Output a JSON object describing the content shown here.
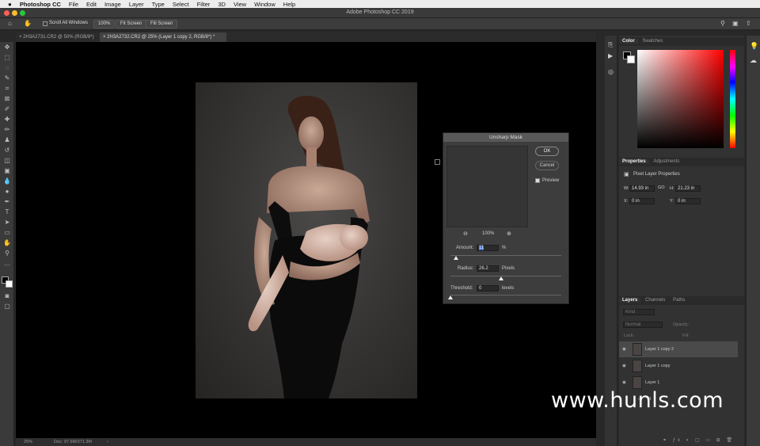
{
  "menu": {
    "apple": "",
    "app": "Photoshop CC",
    "items": [
      "File",
      "Edit",
      "Image",
      "Layer",
      "Type",
      "Select",
      "Filter",
      "3D",
      "View",
      "Window",
      "Help"
    ]
  },
  "window": {
    "title": "Adobe Photoshop CC 2019"
  },
  "options": {
    "scroll_all": "Scroll All Windows",
    "zoom": "100%",
    "fit": "Fit Screen",
    "fill": "Fill Screen"
  },
  "tabs": [
    "2H3A2731.CR2 @ 50% (RGB/8*)",
    "2H3A2732.CR2 @ 25% (Layer 1 copy 2, RGB/8*) *"
  ],
  "status": {
    "zoom": "25%",
    "doc": "Doc: 97.6M/371.3M"
  },
  "dialog": {
    "title": "Unsharp Mask",
    "ok": "OK",
    "cancel": "Cancel",
    "preview": "Preview",
    "zoom": "100%",
    "amount_label": "Amount:",
    "amount_value": "11",
    "amount_unit": "%",
    "radius_label": "Radius:",
    "radius_value": "26.2",
    "radius_unit": "Pixels",
    "threshold_label": "Threshold:",
    "threshold_value": "0",
    "threshold_unit": "levels"
  },
  "color_panel": {
    "tabs": [
      "Color",
      "Swatches"
    ]
  },
  "properties": {
    "tabs": [
      "Properties",
      "Adjustments"
    ],
    "title": "Pixel Layer Properties",
    "w_label": "W:",
    "w": "14.93 in",
    "h_label": "H:",
    "h": "21.23 in",
    "x_label": "X:",
    "x": "0 in",
    "y_label": "Y:",
    "y": "0 in",
    "link": "GO"
  },
  "layers_panel": {
    "tabs": [
      "Layers",
      "Channels",
      "Paths"
    ],
    "kind": "Kind",
    "mode": "Normal",
    "opacity": "Opacity:",
    "lock": "Lock:",
    "fill": "Fill:",
    "group": "fil",
    "layers": [
      "Layer 1 copy 2",
      "Layer 1 copy",
      "Layer 1"
    ]
  },
  "watermark": "www.hunls.com"
}
